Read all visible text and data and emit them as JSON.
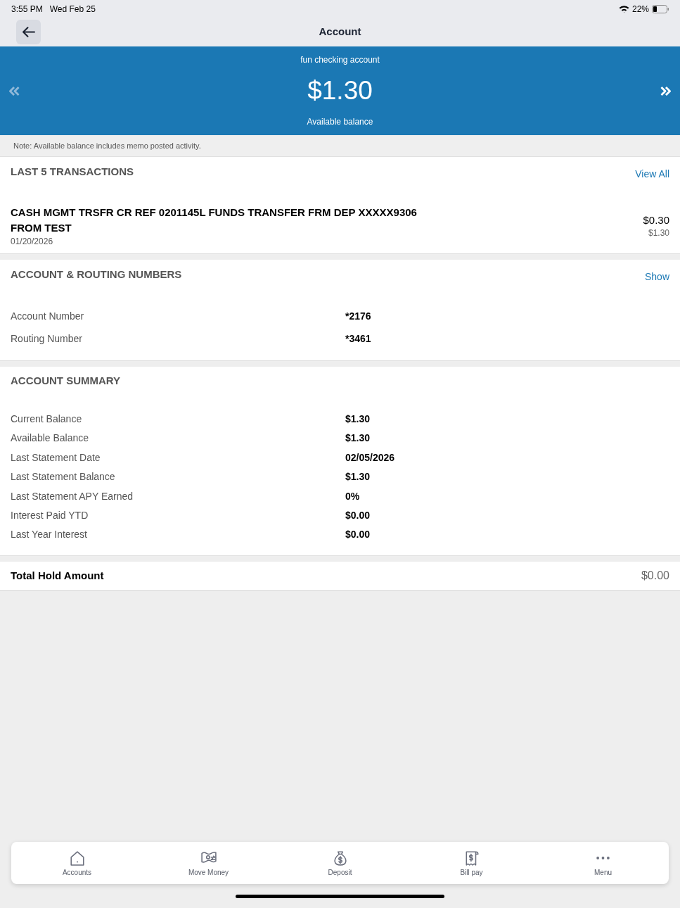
{
  "status_bar": {
    "time": "3:55 PM",
    "date": "Wed Feb 25",
    "battery": "22%"
  },
  "nav_bar": {
    "title": "Account"
  },
  "balance_banner": {
    "account_name": "fun checking account",
    "balance": "$1.30",
    "balance_label": "Available balance"
  },
  "note": "Note: Available balance includes memo posted activity.",
  "transactions": {
    "title": "LAST 5 TRANSACTIONS",
    "link": "View All",
    "items": [
      {
        "description": "CASH MGMT TRSFR CR REF 0201145L FUNDS TRANSFER FRM DEP XXXXX9306 FROM TEST",
        "date": "01/20/2026",
        "amount": "$0.30",
        "running_balance": "$1.30"
      }
    ]
  },
  "account_routing": {
    "title": "ACCOUNT & ROUTING NUMBERS",
    "link": "Show",
    "rows": [
      {
        "label": "Account Number",
        "value": "*2176"
      },
      {
        "label": "Routing Number",
        "value": "*3461"
      }
    ]
  },
  "account_summary": {
    "title": "ACCOUNT SUMMARY",
    "rows": [
      {
        "label": "Current Balance",
        "value": "$1.30"
      },
      {
        "label": "Available Balance",
        "value": "$1.30"
      },
      {
        "label": "Last Statement Date",
        "value": "02/05/2026"
      },
      {
        "label": "Last Statement Balance",
        "value": "$1.30"
      },
      {
        "label": "Last Statement APY Earned",
        "value": "0%"
      },
      {
        "label": "Interest Paid YTD",
        "value": "$0.00"
      },
      {
        "label": "Last Year Interest",
        "value": "$0.00"
      }
    ]
  },
  "total_hold": {
    "label": "Total Hold Amount",
    "value": "$0.00"
  },
  "tab_bar": [
    {
      "label": "Accounts"
    },
    {
      "label": "Move Money"
    },
    {
      "label": "Deposit"
    },
    {
      "label": "Bill pay"
    },
    {
      "label": "Menu"
    }
  ]
}
